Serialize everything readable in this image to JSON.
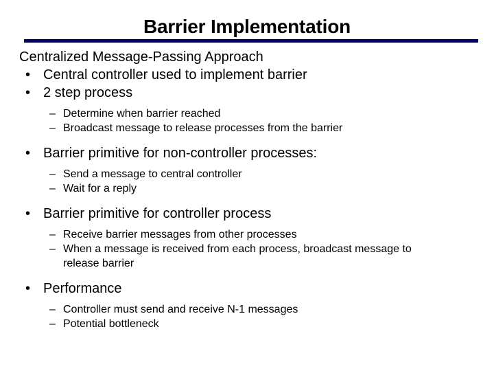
{
  "slide": {
    "title": "Barrier Implementation",
    "rule_color": "#000066",
    "background_color": "#ffffff",
    "text_color": "#000000",
    "markers": {
      "bullet": "•",
      "dash": "–"
    },
    "content": [
      {
        "level": 0,
        "text": "Centralized Message-Passing Approach"
      },
      {
        "level": 1,
        "text": "Central controller used to implement barrier"
      },
      {
        "level": 1,
        "text": "2 step process"
      },
      {
        "level": 2,
        "text": "Determine when barrier reached"
      },
      {
        "level": 2,
        "text": "Broadcast message to release processes from the barrier"
      },
      {
        "level": 1,
        "text": "Barrier primitive for non-controller processes:"
      },
      {
        "level": 2,
        "text": "Send a message to central controller"
      },
      {
        "level": 2,
        "text": "Wait for a reply"
      },
      {
        "level": 1,
        "text": "Barrier primitive for controller process"
      },
      {
        "level": 2,
        "text": "Receive barrier messages from other processes"
      },
      {
        "level": 2,
        "text": "When a message is received from each process, broadcast message to release barrier"
      },
      {
        "level": 1,
        "text": "Performance"
      },
      {
        "level": 2,
        "text": "Controller must send and receive N-1 messages"
      },
      {
        "level": 2,
        "text": "Potential bottleneck"
      }
    ]
  }
}
